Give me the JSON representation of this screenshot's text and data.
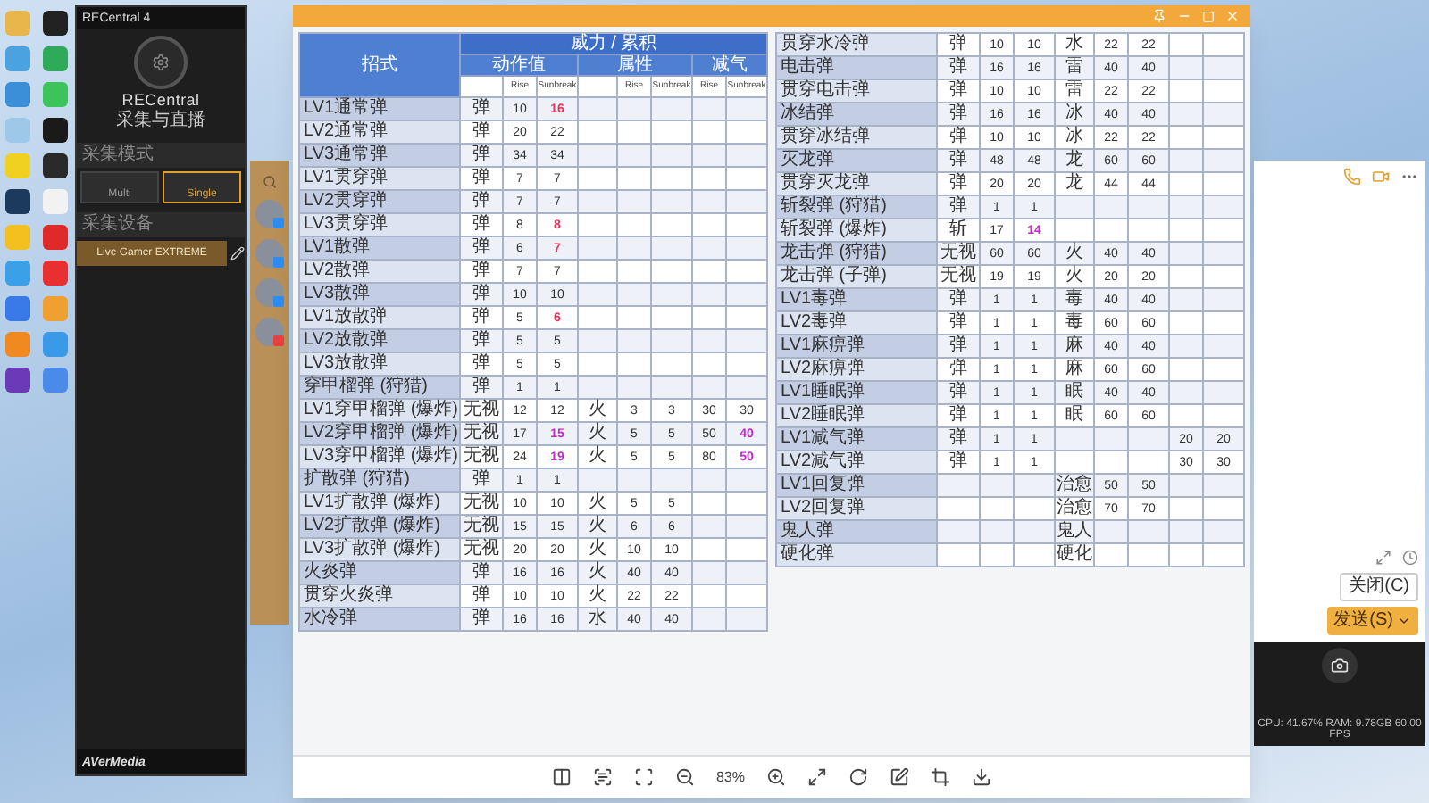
{
  "desktop_icons": [
    {
      "color": "#e8b64a"
    },
    {
      "color": "#222222"
    },
    {
      "color": "#4aa3e0"
    },
    {
      "color": "#2faa5a"
    },
    {
      "color": "#3a8fd8"
    },
    {
      "color": "#3cc45a"
    },
    {
      "color": "#9ec8e8"
    },
    {
      "color": "#1a1a1a"
    },
    {
      "color": "#f0d020"
    },
    {
      "color": "#2a2a2a"
    },
    {
      "color": "#1b3a5c"
    },
    {
      "color": "#f2f2f2"
    },
    {
      "color": "#f4c020"
    },
    {
      "color": "#e02a2a"
    },
    {
      "color": "#3aa0e8"
    },
    {
      "color": "#e83030"
    },
    {
      "color": "#3a7ae8"
    },
    {
      "color": "#f0a030"
    },
    {
      "color": "#f08a20"
    },
    {
      "color": "#3a9ae8"
    },
    {
      "color": "#6a3ab8"
    },
    {
      "color": "#4a8ae8"
    }
  ],
  "recentral": {
    "title": "RECentral 4",
    "logo": "RECentral",
    "subtitle": "采集与直播",
    "mode_label": "采集模式",
    "modes": [
      {
        "label": "Multi",
        "selected": false
      },
      {
        "label": "Single",
        "selected": true
      }
    ],
    "device_label": "采集设备",
    "device": "Live Gamer EXTREME",
    "brand": "AVerMedia"
  },
  "chat": {
    "contacts": [
      {
        "color": "#2d8cf0"
      },
      {
        "color": "#2d8cf0"
      },
      {
        "color": "#2d8cf0"
      },
      {
        "color": "#e84040"
      }
    ],
    "buttons": [
      {
        "label": "关闭(C)",
        "primary": false
      },
      {
        "label": "发送(S)",
        "primary": true
      }
    ]
  },
  "status_bar": {
    "text": "CPU: 41.67%  RAM: 9.78GB  60.00 FPS"
  },
  "table": {
    "header": {
      "move": "招式",
      "group": "威力 / 累积",
      "sections": [
        "动作值",
        "属性",
        "减气"
      ],
      "subheaders": [
        "Rise",
        "Sunbreak",
        "Rise",
        "Sunbreak",
        "Rise",
        "Sunbreak"
      ]
    },
    "rows": [
      {
        "name": "LV1通常弹",
        "type": "弹",
        "motion": [
          "10",
          {
            "text": "16",
            "color": "#e8335a"
          }
        ]
      },
      {
        "name": "LV2通常弹",
        "type": "弹",
        "motion": [
          "20",
          "22"
        ]
      },
      {
        "name": "LV3通常弹",
        "type": "弹",
        "motion": [
          "34",
          "34"
        ]
      },
      {
        "name": "LV1贯穿弹",
        "type": "弹",
        "motion": [
          "7",
          "7"
        ]
      },
      {
        "name": "LV2贯穿弹",
        "type": "弹",
        "motion": [
          "7",
          "7"
        ]
      },
      {
        "name": "LV3贯穿弹",
        "type": "弹",
        "motion": [
          "8",
          {
            "text": "8",
            "color": "#e8335a"
          }
        ]
      },
      {
        "name": "LV1散弹",
        "type": "弹",
        "motion": [
          "6",
          {
            "text": "7",
            "color": "#e8335a"
          }
        ]
      },
      {
        "name": "LV2散弹",
        "type": "弹",
        "motion": [
          "7",
          "7"
        ]
      },
      {
        "name": "LV3散弹",
        "type": "弹",
        "motion": [
          "10",
          "10"
        ]
      },
      {
        "name": "LV1放散弹",
        "type": "弹",
        "motion": [
          "5",
          {
            "text": "6",
            "color": "#e8335a"
          }
        ]
      },
      {
        "name": "LV2放散弹",
        "type": "弹",
        "motion": [
          "5",
          "5"
        ]
      },
      {
        "name": "LV3放散弹",
        "type": "弹",
        "motion": [
          "5",
          "5"
        ]
      },
      {
        "name": "穿甲榴弹 (狩猎)",
        "type": "弹",
        "motion": [
          "1",
          "1"
        ]
      },
      {
        "name": "LV1穿甲榴弹 (爆炸)",
        "type": "无视",
        "motion": [
          "12",
          "12"
        ],
        "element": "火",
        "element_values": [
          "3",
          "3"
        ],
        "exhaust": [
          "30",
          "30"
        ]
      },
      {
        "name": "LV2穿甲榴弹 (爆炸)",
        "type": "无视",
        "motion": [
          "17",
          {
            "text": "15",
            "color": "#c02cc8"
          }
        ],
        "element": "火",
        "element_values": [
          "5",
          "5"
        ],
        "exhaust": [
          "50",
          {
            "text": "40",
            "color": "#c02cc8"
          }
        ]
      },
      {
        "name": "LV3穿甲榴弹 (爆炸)",
        "type": "无视",
        "motion": [
          "24",
          {
            "text": "19",
            "color": "#c02cc8"
          }
        ],
        "element": "火",
        "element_values": [
          "5",
          "5"
        ],
        "exhaust": [
          "80",
          {
            "text": "50",
            "color": "#c02cc8"
          }
        ]
      },
      {
        "name": "扩散弹 (狩猎)",
        "type": "弹",
        "motion": [
          "1",
          "1"
        ]
      },
      {
        "name": "LV1扩散弹 (爆炸)",
        "type": "无视",
        "motion": [
          "10",
          "10"
        ],
        "element": "火",
        "element_values": [
          "5",
          "5"
        ]
      },
      {
        "name": "LV2扩散弹 (爆炸)",
        "type": "无视",
        "motion": [
          "15",
          "15"
        ],
        "element": "火",
        "element_values": [
          "6",
          "6"
        ]
      },
      {
        "name": "LV3扩散弹 (爆炸)",
        "type": "无视",
        "motion": [
          "20",
          "20"
        ],
        "element": "火",
        "element_values": [
          "10",
          "10"
        ]
      },
      {
        "name": "火炎弹",
        "type": "弹",
        "motion": [
          "16",
          "16"
        ],
        "element": "火",
        "element_values": [
          "40",
          "40"
        ]
      },
      {
        "name": "贯穿火炎弹",
        "type": "弹",
        "motion": [
          "10",
          "10"
        ],
        "element": "火",
        "element_values": [
          "22",
          "22"
        ]
      },
      {
        "name": "水冷弹",
        "type": "弹",
        "motion": [
          "16",
          "16"
        ],
        "element": "水",
        "element_values": [
          "40",
          "40"
        ]
      },
      {
        "name": "贯穿水冷弹",
        "type": "弹",
        "motion": [
          "10",
          "10"
        ],
        "element": "水",
        "element_values": [
          "22",
          "22"
        ]
      },
      {
        "name": "电击弹",
        "type": "弹",
        "motion": [
          "16",
          "16"
        ],
        "element": "雷",
        "element_values": [
          "40",
          "40"
        ]
      },
      {
        "name": "贯穿电击弹",
        "type": "弹",
        "motion": [
          "10",
          "10"
        ],
        "element": "雷",
        "element_values": [
          "22",
          "22"
        ]
      },
      {
        "name": "冰结弹",
        "type": "弹",
        "motion": [
          "16",
          "16"
        ],
        "element": "冰",
        "element_values": [
          "40",
          "40"
        ]
      },
      {
        "name": "贯穿冰结弹",
        "type": "弹",
        "motion": [
          "10",
          "10"
        ],
        "element": "冰",
        "element_values": [
          "22",
          "22"
        ]
      },
      {
        "name": "灭龙弹",
        "type": "弹",
        "motion": [
          "48",
          "48"
        ],
        "element": "龙",
        "element_values": [
          "60",
          "60"
        ]
      },
      {
        "name": "贯穿灭龙弹",
        "type": "弹",
        "motion": [
          "20",
          "20"
        ],
        "element": "龙",
        "element_values": [
          "44",
          "44"
        ]
      },
      {
        "name": "斩裂弹 (狩猎)",
        "type": "弹",
        "motion": [
          "1",
          "1"
        ]
      },
      {
        "name": "斩裂弹 (爆炸)",
        "type": "斩",
        "motion": [
          "17",
          {
            "text": "14",
            "color": "#c02cc8"
          }
        ]
      },
      {
        "name": "龙击弹 (狩猎)",
        "type": "无视",
        "motion": [
          "60",
          "60"
        ],
        "element": "火",
        "element_values": [
          "40",
          "40"
        ]
      },
      {
        "name": "龙击弹 (子弹)",
        "type": "无视",
        "motion": [
          "19",
          "19"
        ],
        "element": "火",
        "element_values": [
          "20",
          "20"
        ]
      },
      {
        "name": "LV1毒弹",
        "type": "弹",
        "motion": [
          "1",
          "1"
        ],
        "element": "毒",
        "element_values": [
          "40",
          "40"
        ]
      },
      {
        "name": "LV2毒弹",
        "type": "弹",
        "motion": [
          "1",
          "1"
        ],
        "element": "毒",
        "element_values": [
          "60",
          "60"
        ]
      },
      {
        "name": "LV1麻痹弹",
        "type": "弹",
        "motion": [
          "1",
          "1"
        ],
        "element": "麻",
        "element_values": [
          "40",
          "40"
        ]
      },
      {
        "name": "LV2麻痹弹",
        "type": "弹",
        "motion": [
          "1",
          "1"
        ],
        "element": "麻",
        "element_values": [
          "60",
          "60"
        ]
      },
      {
        "name": "LV1睡眠弹",
        "type": "弹",
        "motion": [
          "1",
          "1"
        ],
        "element": "眠",
        "element_values": [
          "40",
          "40"
        ]
      },
      {
        "name": "LV2睡眠弹",
        "type": "弹",
        "motion": [
          "1",
          "1"
        ],
        "element": "眠",
        "element_values": [
          "60",
          "60"
        ]
      },
      {
        "name": "LV1减气弹",
        "type": "弹",
        "motion": [
          "1",
          "1"
        ],
        "exhaust": [
          "20",
          "20"
        ]
      },
      {
        "name": "LV2减气弹",
        "type": "弹",
        "motion": [
          "1",
          "1"
        ],
        "exhaust": [
          "30",
          "30"
        ]
      },
      {
        "name": "LV1回复弹",
        "element": "治愈",
        "element_values": [
          "50",
          "50"
        ]
      },
      {
        "name": "LV2回复弹",
        "element": "治愈",
        "element_values": [
          "70",
          "70"
        ]
      },
      {
        "name": "鬼人弹",
        "element": "鬼人"
      },
      {
        "name": "硬化弹",
        "element": "硬化"
      }
    ]
  },
  "viewer_toolbar": {
    "zoom": "83%"
  }
}
